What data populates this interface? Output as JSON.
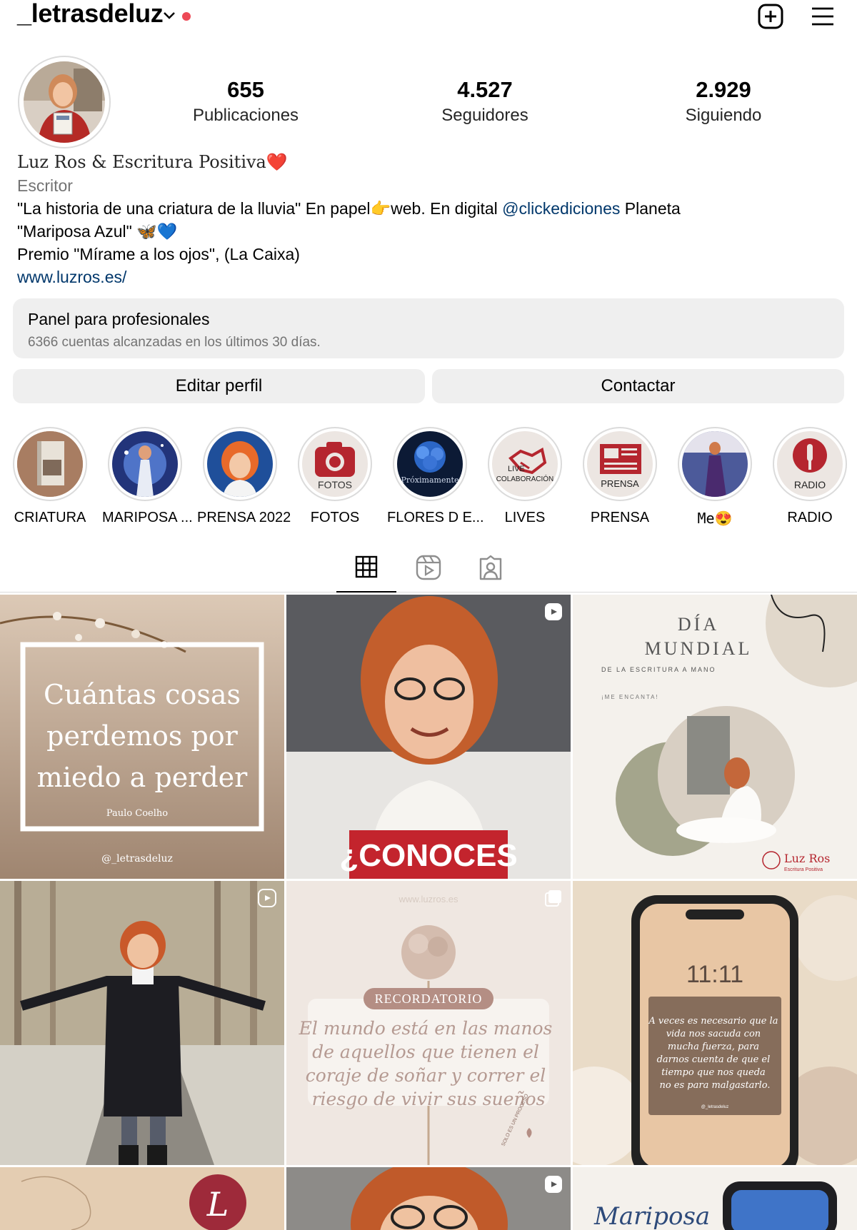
{
  "header": {
    "username": "_letrasdeluz",
    "icons": [
      "chevron-down-icon",
      "notification-dot",
      "new-post-icon",
      "menu-icon"
    ]
  },
  "stats": [
    {
      "value": "655",
      "label": "Publicaciones"
    },
    {
      "value": "4.527",
      "label": "Seguidores"
    },
    {
      "value": "2.929",
      "label": "Siguiendo"
    }
  ],
  "bio": {
    "name": "Luz Ros & Escritura Positiva❤️",
    "category": "Escritor",
    "line1_a": "\"La historia de una criatura de la lluvia\" En papel👉web. En digital ",
    "line1_mention": "@clickediciones",
    "line1_b": " Planeta",
    "line2": "\"Mariposa Azul\" 🦋💙",
    "line3": "Premio \"Mírame a los ojos\", (La Caixa)",
    "link": "www.luzros.es/"
  },
  "pro_panel": {
    "title": "Panel para profesionales",
    "subtitle": "6366 cuentas alcanzadas en los últimos 30 días."
  },
  "buttons": {
    "edit": "Editar perfil",
    "contact": "Contactar"
  },
  "highlights": [
    {
      "label": "CRIATURA"
    },
    {
      "label": "MARIPOSA ..."
    },
    {
      "label": "PRENSA 2022"
    },
    {
      "label": "FOTOS",
      "icon_text": "FOTOS"
    },
    {
      "label": "FLORES D E...",
      "icon_text": "Próximamente"
    },
    {
      "label": "LIVES",
      "icon_text_a": "LIVE",
      "icon_text_b": "COLABORACIÓN"
    },
    {
      "label": "PRENSA",
      "icon_text": "PRENSA"
    },
    {
      "label": "Me😍"
    },
    {
      "label": "RADIO",
      "icon_text": "RADIO"
    }
  ],
  "tabs": [
    "grid-icon",
    "reels-icon",
    "tagged-icon"
  ],
  "posts": [
    {
      "text": "Cuántas cosas perdemos por miedo a perder",
      "author": "Paulo Coelho",
      "handle": "@_letrasdeluz"
    },
    {
      "banner": "¿CONOCES",
      "type": "reel"
    },
    {
      "title_a": "DÍA",
      "title_b": "MUNDIAL",
      "subtitle": "DE LA ESCRITURA A MANO",
      "small": "¡ME ENCANTA!",
      "brand": "Luz Ros",
      "brand_sub": "Escritura Positiva"
    },
    {
      "type": "reel"
    },
    {
      "site": "www.luzros.es",
      "badge": "RECORDATORIO",
      "quote": "El mundo está en las manos de aquellos que tienen el coraje de soñar y correr el riesgo de vivir sus sueños",
      "ring": "SOLO ES UN PROCESO",
      "type": "carousel"
    },
    {
      "time": "11:11",
      "quote": "A veces es necesario que la vida nos sacuda con mucha fuerza, para darnos cuenta de que el tiempo que nos queda no es para malgastarlo.",
      "handle": "@_letrasdeluz"
    },
    {
      "monogram": "L"
    },
    {
      "type": "reel"
    },
    {
      "script": "Mariposa"
    }
  ]
}
